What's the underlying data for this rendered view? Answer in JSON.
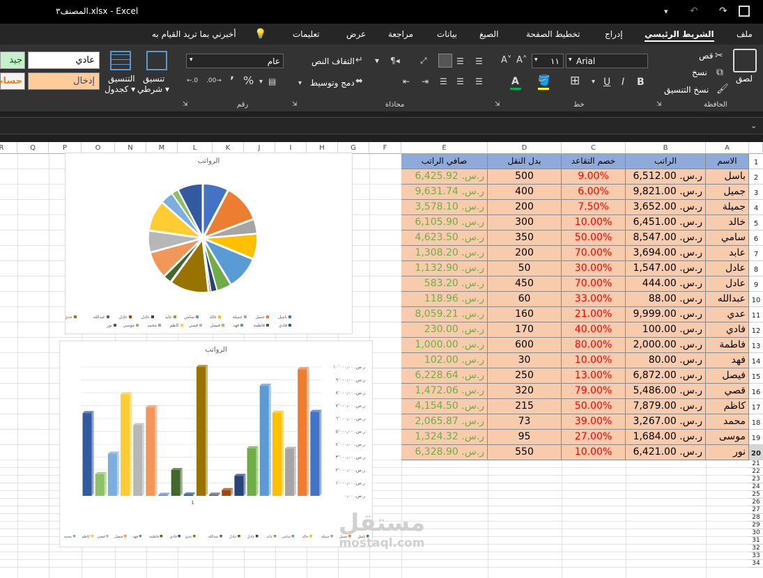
{
  "titlebar": {
    "title": "المصنف٣.xlsx  -  Excel"
  },
  "tabs": [
    "ملف",
    "الشريط الرئيسي",
    "إدراج",
    "تخطيط الصفحة",
    "الصيغ",
    "بيانات",
    "مراجعة",
    "عرض",
    "تعليمات"
  ],
  "tellme": "أخبرني بما تريد القيام به",
  "clipboard": {
    "paste": "لصق",
    "cut": "قص",
    "copy": "نسخ",
    "format_painter": "نسخ التنسيق",
    "group": "الحافظة"
  },
  "font": {
    "name": "Arial",
    "size": "١١",
    "group": "خط"
  },
  "alignment": {
    "wrap": "التفاف النص",
    "merge": "دمج وتوسيط",
    "group": "محاذاة"
  },
  "number": {
    "format": "عام",
    "group": "رقم"
  },
  "styles": {
    "conditional": "تنسيق شرطي",
    "table": "التنسيق كجدول",
    "normal": "عادي",
    "good": "جيد",
    "input": "إدخال",
    "calc": "حساب"
  },
  "columns": [
    "A",
    "B",
    "C",
    "D",
    "E",
    "F",
    "G",
    "H",
    "I",
    "J",
    "K",
    "L",
    "M",
    "N",
    "O",
    "P",
    "Q",
    "R"
  ],
  "rows": [
    "1",
    "2",
    "3",
    "4",
    "5",
    "6",
    "7",
    "8",
    "9",
    "10",
    "11",
    "12",
    "13",
    "14",
    "15",
    "16",
    "17",
    "18",
    "19",
    "20",
    "21",
    "22",
    "23",
    "24",
    "25",
    "26",
    "27",
    "28",
    "29",
    "30",
    "31",
    "32",
    "33",
    "34"
  ],
  "table": {
    "headers": [
      "الاسم",
      "الراتب",
      "خصم التقاعد",
      "بدل النقل",
      "صافي الراتب"
    ],
    "rows": [
      [
        "باسل",
        "ر.س. 6,512.00",
        "9.00%",
        "500",
        "ر.س. 6,425.92"
      ],
      [
        "جميل",
        "ر.س. 9,821.00",
        "6.00%",
        "400",
        "ر.س. 9,631.74"
      ],
      [
        "جميلة",
        "ر.س. 3,652.00",
        "7.50%",
        "200",
        "ر.س. 3,578.10"
      ],
      [
        "خالد",
        "ر.س. 6,451.00",
        "10.00%",
        "300",
        "ر.س. 6,105.90"
      ],
      [
        "سامي",
        "ر.س. 8,547.00",
        "50.00%",
        "350",
        "ر.س. 4,623.50"
      ],
      [
        "عابد",
        "ر.س. 3,694.00",
        "70.00%",
        "200",
        "ر.س. 1,308.20"
      ],
      [
        "عادل",
        "ر.س. 1,547.00",
        "30.00%",
        "50",
        "ر.س. 1,132.90"
      ],
      [
        "عادل",
        "ر.س. 444.00",
        "70.00%",
        "450",
        "ر.س. 583.20"
      ],
      [
        "عبدالله",
        "ر.س. 88.00",
        "33.00%",
        "60",
        "ر.س. 118.96"
      ],
      [
        "عدي",
        "ر.س. 9,999.00",
        "21.00%",
        "160",
        "ر.س. 8,059.21"
      ],
      [
        "فادي",
        "ر.س. 100.00",
        "40.00%",
        "170",
        "ر.س. 230.00"
      ],
      [
        "فاطمة",
        "ر.س. 2,000.00",
        "80.00%",
        "600",
        "ر.س. 1,000.00"
      ],
      [
        "فهد",
        "ر.س. 80.00",
        "10.00%",
        "30",
        "ر.س. 102.00"
      ],
      [
        "فيصل",
        "ر.س. 6,872.00",
        "13.00%",
        "250",
        "ر.س. 6,228.64"
      ],
      [
        "قصي",
        "ر.س. 5,486.00",
        "79.00%",
        "320",
        "ر.س. 1,472.06"
      ],
      [
        "كاظم",
        "ر.س. 7,879.00",
        "50.00%",
        "215",
        "ر.س. 4,154.50"
      ],
      [
        "محمد",
        "ر.س. 3,267.00",
        "39.00%",
        "73",
        "ر.س. 2,065.87"
      ],
      [
        "موسى",
        "ر.س. 1,684.00",
        "27.00%",
        "95",
        "ر.س. 1,324.32"
      ],
      [
        "نور",
        "ر.س. 6,421.00",
        "10.00%",
        "550",
        "ر.س. 6,328.90"
      ]
    ]
  },
  "chart_data": [
    {
      "type": "pie",
      "title": "الرواتب",
      "categories": [
        "باسل",
        "جميل",
        "جميلة",
        "خالد",
        "سامي",
        "عابد",
        "عادل",
        "عادل",
        "عبدالله",
        "عدي",
        "فادي",
        "فاطمة",
        "فهد",
        "فيصل",
        "قصي",
        "كاظم",
        "محمد",
        "موسى",
        "نور"
      ],
      "values": [
        6512,
        9821,
        3652,
        6451,
        8547,
        3694,
        1547,
        444,
        88,
        9999,
        100,
        2000,
        80,
        6872,
        5486,
        7879,
        3267,
        1684,
        6421
      ],
      "colors": [
        "#4472c4",
        "#ed7d31",
        "#a5a5a5",
        "#ffc000",
        "#5b9bd5",
        "#70ad47",
        "#264478",
        "#9e480e",
        "#636363",
        "#997300",
        "#255e91",
        "#43682b",
        "#698ed0",
        "#f1975a",
        "#b7b7b7",
        "#ffcd33",
        "#7cafdd",
        "#8cc168",
        "#335aa1"
      ],
      "legend": "bottom"
    },
    {
      "type": "bar",
      "title": "الرواتب",
      "categories": [
        "1"
      ],
      "series_names": [
        "باسل",
        "جميل",
        "جميلة",
        "خالد",
        "سامي",
        "عابد",
        "عادل",
        "عادل",
        "عبدالله",
        "عدي",
        "فادي",
        "فاطمة",
        "فهد",
        "فيصل",
        "قصي",
        "كاظم",
        "محمد",
        "موسى",
        "نور"
      ],
      "values": [
        6512,
        9821,
        3652,
        6451,
        8547,
        3694,
        1547,
        444,
        88,
        9999,
        100,
        2000,
        80,
        6872,
        5486,
        7879,
        3267,
        1684,
        6421
      ],
      "colors": [
        "#4472c4",
        "#ed7d31",
        "#a5a5a5",
        "#ffc000",
        "#5b9bd5",
        "#70ad47",
        "#264478",
        "#9e480e",
        "#636363",
        "#997300",
        "#255e91",
        "#43682b",
        "#698ed0",
        "#f1975a",
        "#b7b7b7",
        "#ffcd33",
        "#7cafdd",
        "#8cc168",
        "#335aa1"
      ],
      "ylim": [
        0,
        10000
      ],
      "yticks": [
        "ر.س. ٠٫٠٠",
        "ر.س. ١٬٠٠٠٫٠٠",
        "ر.س. ٢٬٠٠٠٫٠٠",
        "ر.س. ٣٬٠٠٠٫٠٠",
        "ر.س. ٤٬٠٠٠٫٠٠",
        "ر.س. ٥٬٠٠٠٫٠٠",
        "ر.س. ٦٬٠٠٠٫٠٠",
        "ر.س. ٧٬٠٠٠٫٠٠",
        "ر.س. ٨٬٠٠٠٫٠٠",
        "ر.س. ٩٬٠٠٠٫٠٠",
        "ر.س. ١٠٬٠٠٠٫٠٠"
      ],
      "legend": "bottom"
    }
  ],
  "watermark": {
    "ar": "مستقل",
    "en": "mostaql.com"
  }
}
